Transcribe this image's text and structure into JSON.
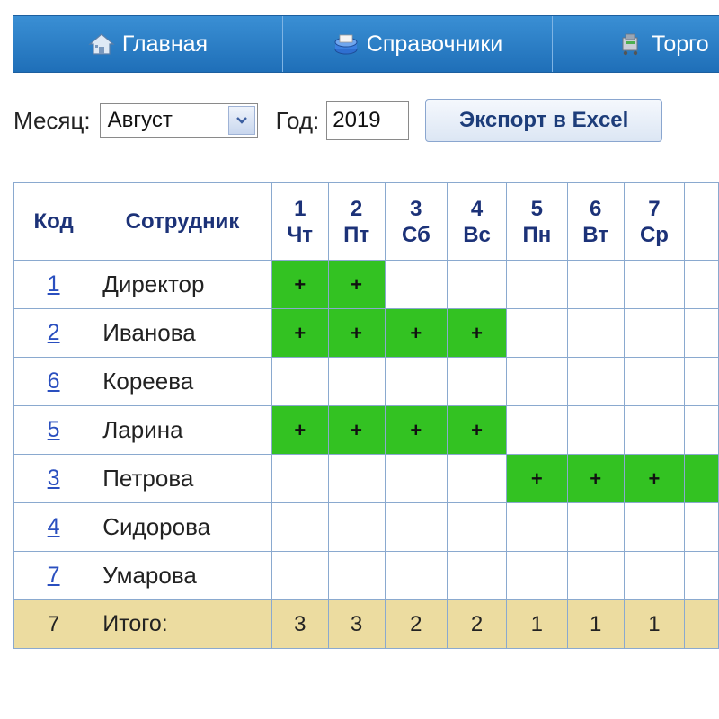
{
  "nav": {
    "items": [
      {
        "label": "Главная",
        "icon": "home-icon"
      },
      {
        "label": "Справочники",
        "icon": "catalog-icon"
      },
      {
        "label": "Торго",
        "icon": "trade-icon"
      }
    ]
  },
  "filters": {
    "month_label": "Месяц:",
    "month_value": "Август",
    "year_label": "Год:",
    "year_value": "2019",
    "export_label": "Экспорт в Excel"
  },
  "table": {
    "headers": {
      "code": "Код",
      "employee": "Сотрудник"
    },
    "days": [
      {
        "num": "1",
        "dow": "Чт"
      },
      {
        "num": "2",
        "dow": "Пт"
      },
      {
        "num": "3",
        "dow": "Сб"
      },
      {
        "num": "4",
        "dow": "Вс"
      },
      {
        "num": "5",
        "dow": "Пн"
      },
      {
        "num": "6",
        "dow": "Вт"
      },
      {
        "num": "7",
        "dow": "Ср"
      }
    ],
    "rows": [
      {
        "code": "1",
        "name": "Директор",
        "marks": [
          "+",
          "+",
          "",
          "",
          "",
          "",
          ""
        ]
      },
      {
        "code": "2",
        "name": "Иванова",
        "marks": [
          "+",
          "+",
          "+",
          "+",
          "",
          "",
          ""
        ]
      },
      {
        "code": "6",
        "name": "Кореева",
        "marks": [
          "",
          "",
          "",
          "",
          "",
          "",
          ""
        ]
      },
      {
        "code": "5",
        "name": "Ларина",
        "marks": [
          "+",
          "+",
          "+",
          "+",
          "",
          "",
          ""
        ]
      },
      {
        "code": "3",
        "name": "Петрова",
        "marks": [
          "",
          "",
          "",
          "",
          "+",
          "+",
          "+"
        ]
      },
      {
        "code": "4",
        "name": "Сидорова",
        "marks": [
          "",
          "",
          "",
          "",
          "",
          "",
          ""
        ]
      },
      {
        "code": "7",
        "name": "Умарова",
        "marks": [
          "",
          "",
          "",
          "",
          "",
          "",
          ""
        ]
      }
    ],
    "total": {
      "count": "7",
      "label": "Итого:",
      "values": [
        "3",
        "3",
        "2",
        "2",
        "1",
        "1",
        "1"
      ]
    }
  },
  "colors": {
    "nav_blue": "#2a7fcb",
    "present_green": "#33c222",
    "total_row": "#ecdca0",
    "header_text": "#1c3278",
    "link": "#2a4fbf"
  }
}
